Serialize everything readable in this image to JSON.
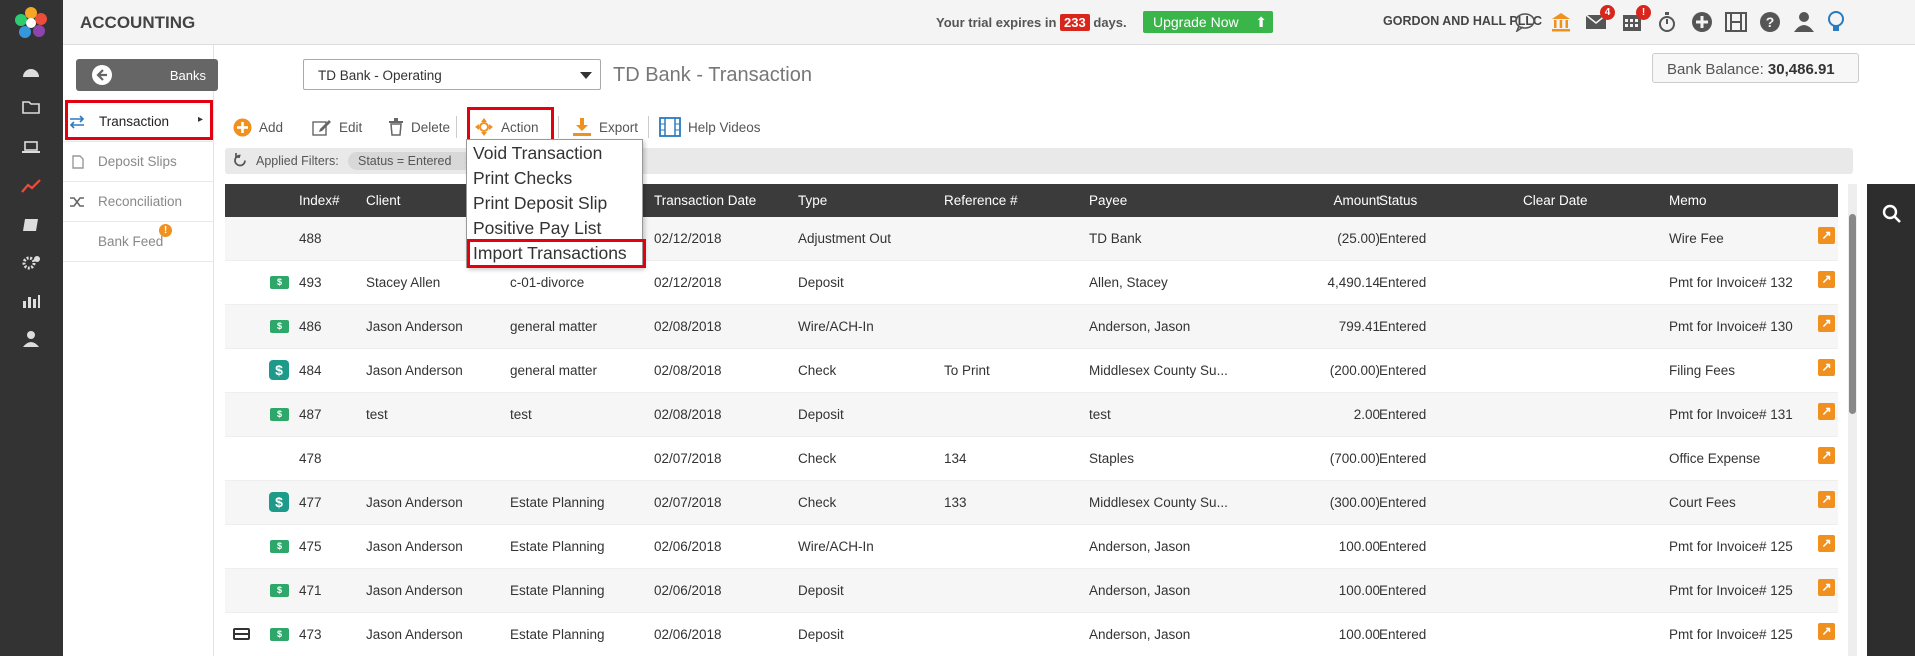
{
  "app_title": "ACCOUNTING",
  "trial": {
    "prefix": "Your trial expires in",
    "days": "233",
    "suffix": "days."
  },
  "upgrade_label": "Upgrade Now",
  "firm_name": "GORDON AND HALL PLLC",
  "badges": {
    "mail": "4",
    "calendar": "!"
  },
  "sidebar": {
    "banks_button": "Banks",
    "items": [
      {
        "label": "Transaction"
      },
      {
        "label": "Deposit Slips"
      },
      {
        "label": "Reconciliation"
      },
      {
        "label": "Bank Feed"
      }
    ]
  },
  "account_select": "TD Bank - Operating",
  "page_title": "TD Bank - Transaction",
  "bank_balance": {
    "label": "Bank Balance:",
    "value": "30,486.91"
  },
  "toolbar": {
    "add": "Add",
    "edit": "Edit",
    "delete": "Delete",
    "action": "Action",
    "export": "Export",
    "help": "Help Videos"
  },
  "filters": {
    "label": "Applied Filters:",
    "chip": "Status = Entered"
  },
  "action_menu": [
    "Void Transaction",
    "Print Checks",
    "Print Deposit Slip",
    "Positive Pay List",
    "Import Transactions"
  ],
  "columns": {
    "index": "Index#",
    "client": "Client",
    "date": "Transaction Date",
    "type": "Type",
    "ref": "Reference #",
    "payee": "Payee",
    "amount": "Amount",
    "status": "Status",
    "clear": "Clear Date",
    "memo": "Memo"
  },
  "rows": [
    {
      "index": "488",
      "client": "",
      "matter": "",
      "date": "02/12/2018",
      "type": "Adjustment Out",
      "ref": "",
      "payee": "TD Bank",
      "amount": "(25.00)",
      "status": "Entered",
      "clear": "",
      "memo": "Wire Fee",
      "icon": ""
    },
    {
      "index": "493",
      "client": "Stacey Allen",
      "matter": "c-01-divorce",
      "date": "02/12/2018",
      "type": "Deposit",
      "ref": "",
      "payee": "Allen, Stacey",
      "amount": "4,490.14",
      "status": "Entered",
      "clear": "",
      "memo": "Pmt for Invoice# 132",
      "icon": "cash"
    },
    {
      "index": "486",
      "client": "Jason Anderson",
      "matter": "general matter",
      "date": "02/08/2018",
      "type": "Wire/ACH-In",
      "ref": "",
      "payee": "Anderson, Jason",
      "amount": "799.41",
      "status": "Entered",
      "clear": "",
      "memo": "Pmt for Invoice# 130",
      "icon": "cash"
    },
    {
      "index": "484",
      "client": "Jason Anderson",
      "matter": "general matter",
      "date": "02/08/2018",
      "type": "Check",
      "ref": "To Print",
      "payee": "Middlesex County Su...",
      "amount": "(200.00)",
      "status": "Entered",
      "clear": "",
      "memo": "Filing Fees",
      "icon": "dollar"
    },
    {
      "index": "487",
      "client": "test",
      "matter": "test",
      "date": "02/08/2018",
      "type": "Deposit",
      "ref": "",
      "payee": "test",
      "amount": "2.00",
      "status": "Entered",
      "clear": "",
      "memo": "Pmt for Invoice# 131",
      "icon": "cash"
    },
    {
      "index": "478",
      "client": "",
      "matter": "",
      "date": "02/07/2018",
      "type": "Check",
      "ref": "134",
      "payee": "Staples",
      "amount": "(700.00)",
      "status": "Entered",
      "clear": "",
      "memo": "Office Expense",
      "icon": ""
    },
    {
      "index": "477",
      "client": "Jason Anderson",
      "matter": "Estate Planning",
      "date": "02/07/2018",
      "type": "Check",
      "ref": "133",
      "payee": "Middlesex County Su...",
      "amount": "(300.00)",
      "status": "Entered",
      "clear": "",
      "memo": "Court Fees",
      "icon": "dollar"
    },
    {
      "index": "475",
      "client": "Jason Anderson",
      "matter": "Estate Planning",
      "date": "02/06/2018",
      "type": "Wire/ACH-In",
      "ref": "",
      "payee": "Anderson, Jason",
      "amount": "100.00",
      "status": "Entered",
      "clear": "",
      "memo": "Pmt for Invoice# 125",
      "icon": "cash"
    },
    {
      "index": "471",
      "client": "Jason Anderson",
      "matter": "Estate Planning",
      "date": "02/06/2018",
      "type": "Deposit",
      "ref": "",
      "payee": "Anderson, Jason",
      "amount": "100.00",
      "status": "Entered",
      "clear": "",
      "memo": "Pmt for Invoice# 125",
      "icon": "cash"
    },
    {
      "index": "473",
      "client": "Jason Anderson",
      "matter": "Estate Planning",
      "date": "02/06/2018",
      "type": "Deposit",
      "ref": "",
      "payee": "Anderson, Jason",
      "amount": "100.00",
      "status": "Entered",
      "clear": "",
      "memo": "Pmt for Invoice# 125",
      "icon": "cash",
      "card": true
    }
  ],
  "colors": {
    "accent": "#f0901e",
    "highlight": "#e3000f",
    "upgrade": "#3ab54a",
    "header": "#3b3b3b"
  }
}
